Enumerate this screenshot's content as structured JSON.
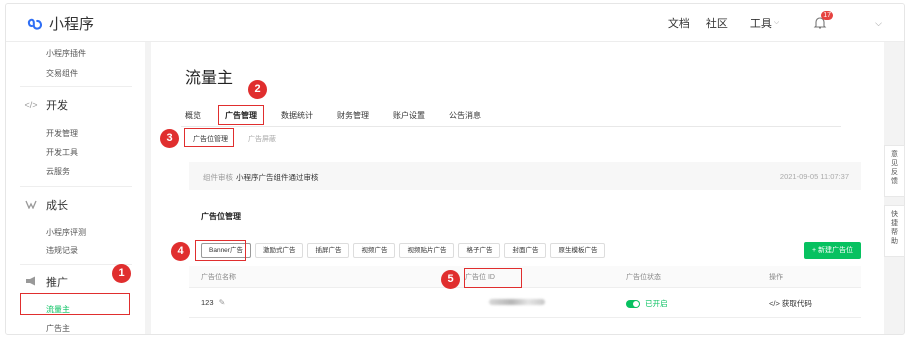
{
  "app": {
    "title": "小程序"
  },
  "topnav": {
    "docs": "文档",
    "community": "社区",
    "tools": "工具",
    "badge": "17"
  },
  "sidebar": {
    "items_top": [
      "小程序插件",
      "交易组件"
    ],
    "groups": [
      {
        "label": "开发",
        "icon": "code-icon",
        "items": [
          "开发管理",
          "开发工具",
          "云服务"
        ]
      },
      {
        "label": "成长",
        "icon": "growth-icon",
        "items": [
          "小程序评测",
          "违规记录"
        ]
      },
      {
        "label": "推广",
        "icon": "megaphone-icon",
        "items": [
          "流量主",
          "广告主"
        ]
      }
    ]
  },
  "main": {
    "title": "流量主",
    "tabs": [
      "概览",
      "广告管理",
      "数据统计",
      "财务管理",
      "账户设置",
      "公告消息"
    ],
    "subtabs": [
      "广告位管理",
      "广告屏蔽"
    ],
    "notice": {
      "label": "组件审核",
      "message": "小程序广告组件通过审核",
      "time": "2021-09-05 11:07:37"
    },
    "card": {
      "title": "广告位管理",
      "filters": [
        "Banner广告",
        "激励式广告",
        "插屏广告",
        "视频广告",
        "视频贴片广告",
        "格子广告",
        "封面广告",
        "原生模板广告"
      ],
      "add_button": "+ 新建广告位",
      "columns": [
        "广告位名称",
        "广告位 ID",
        "广告位状态",
        "操作"
      ],
      "rows": [
        {
          "name": "123",
          "status": "已开启",
          "action": "</> 获取代码"
        }
      ]
    }
  },
  "float": {
    "feedback": "意见反馈",
    "help": "快捷帮助"
  },
  "callouts": [
    "1",
    "2",
    "3",
    "4",
    "5"
  ],
  "colors": {
    "accent": "#07c160",
    "callout": "#e02e2e"
  }
}
